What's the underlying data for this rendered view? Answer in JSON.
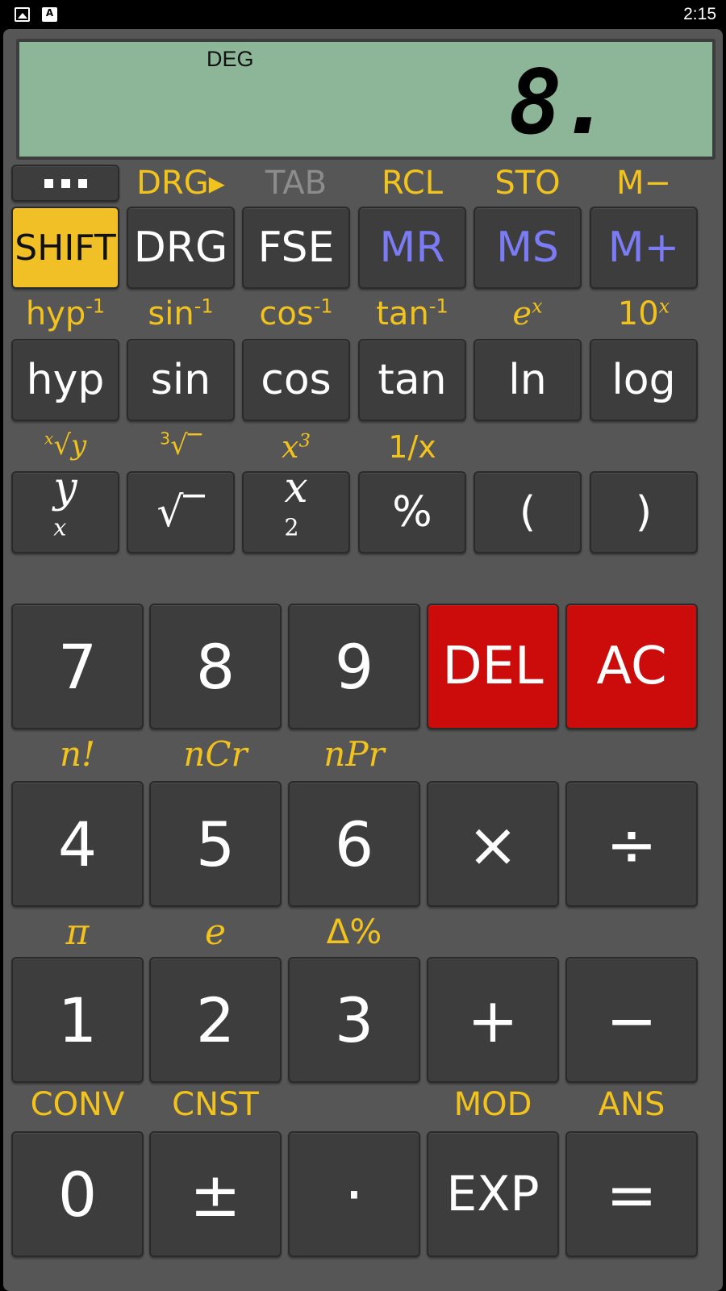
{
  "status_bar": {
    "time": "2:15",
    "icons": [
      "image-icon",
      "text-a-icon"
    ]
  },
  "display": {
    "angle_mode": "DEG",
    "value": "8."
  },
  "menu_button": {
    "icon": "more-dots-icon"
  },
  "row0": {
    "shift_labels": [
      "DRG▸",
      "TAB",
      "RCL",
      "STO",
      "M−"
    ],
    "keys": [
      "SHIFT",
      "DRG",
      "FSE",
      "MR",
      "MS",
      "M+"
    ]
  },
  "row1": {
    "shift_labels": [
      {
        "base": "hyp",
        "sup": "-1"
      },
      {
        "base": "sin",
        "sup": "-1"
      },
      {
        "base": "cos",
        "sup": "-1"
      },
      {
        "base": "tan",
        "sup": "-1"
      },
      {
        "base": "e",
        "sup": "x"
      },
      {
        "base": "10",
        "sup": "x"
      }
    ],
    "keys": [
      "hyp",
      "sin",
      "cos",
      "tan",
      "ln",
      "log"
    ]
  },
  "row2": {
    "shift_labels": [
      {
        "pre": "x",
        "base": "√y"
      },
      {
        "pre": "3",
        "base": "√‾"
      },
      {
        "base": "x",
        "sup": "3"
      },
      {
        "base": "1/x"
      }
    ],
    "keys": [
      {
        "base": "y",
        "sup": "x"
      },
      {
        "base": "√‾"
      },
      {
        "base": "x",
        "sup": "2"
      },
      {
        "base": "%"
      },
      {
        "base": "("
      },
      {
        "base": ")"
      }
    ]
  },
  "row3": {
    "keys": [
      "7",
      "8",
      "9",
      "DEL",
      "AC"
    ]
  },
  "row4": {
    "shift_labels": [
      "n!",
      "nCr",
      "nPr"
    ],
    "keys": [
      "4",
      "5",
      "6",
      "×",
      "÷"
    ]
  },
  "row5": {
    "shift_labels": [
      "π",
      "e",
      "Δ%"
    ],
    "keys": [
      "1",
      "2",
      "3",
      "+",
      "−"
    ]
  },
  "row6": {
    "shift_labels": [
      "CONV",
      "CNST",
      "MOD",
      "ANS"
    ],
    "keys": [
      "0",
      "±",
      "·",
      "EXP",
      "="
    ]
  },
  "colors": {
    "display_bg": "#8db597",
    "shift_key": "#f0c026",
    "shift_text": "#f2c21d",
    "red_key": "#cc0b0b",
    "memory_text": "#7b7bf6",
    "key_bg": "#3d3d3d",
    "panel_bg": "#565656"
  }
}
